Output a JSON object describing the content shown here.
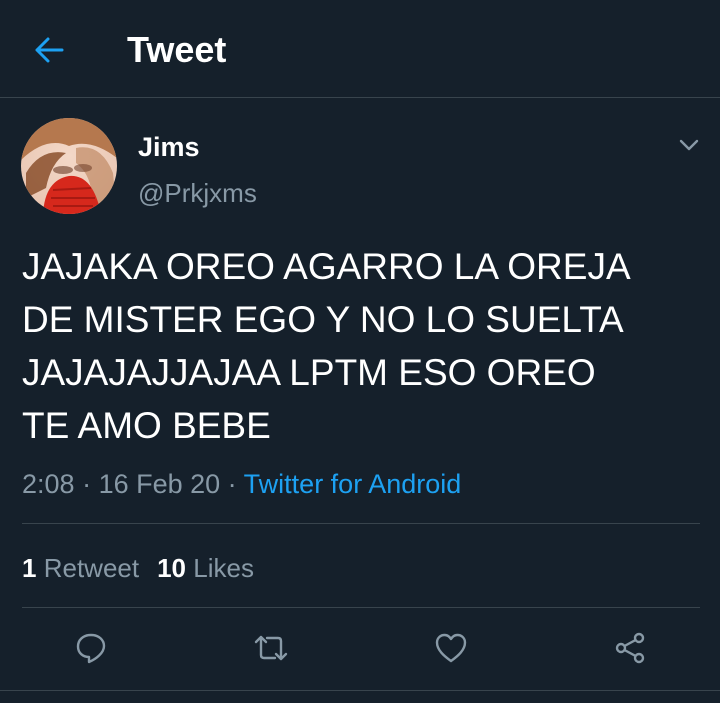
{
  "header": {
    "title": "Tweet",
    "back_icon": "arrow-left-icon",
    "accent_color": "#1da1f2"
  },
  "tweet": {
    "author": {
      "display_name": "Jims",
      "handle": "@Prkjxms",
      "avatar": "avatar-photo"
    },
    "text_lines": [
      "JAJAKA OREO AGARRO LA OREJA",
      "DE MISTER EGO Y NO LO SUELTA",
      "JAJAJAJJAJAA LPTM ESO OREO",
      "TE AMO BEBE"
    ],
    "time": "2:08",
    "separator": " · ",
    "date": "16 Feb 20",
    "source": "Twitter for Android",
    "stats": {
      "retweets_count": "1",
      "retweets_label": "Retweet",
      "likes_count": "10",
      "likes_label": "Likes"
    }
  },
  "actions": [
    {
      "icon": "reply-icon"
    },
    {
      "icon": "retweet-icon"
    },
    {
      "icon": "like-icon"
    },
    {
      "icon": "share-icon"
    }
  ],
  "colors": {
    "background": "#15202b",
    "text": "#ffffff",
    "secondary_text": "#8899a6",
    "divider": "#38444d",
    "link": "#1da1f2"
  }
}
